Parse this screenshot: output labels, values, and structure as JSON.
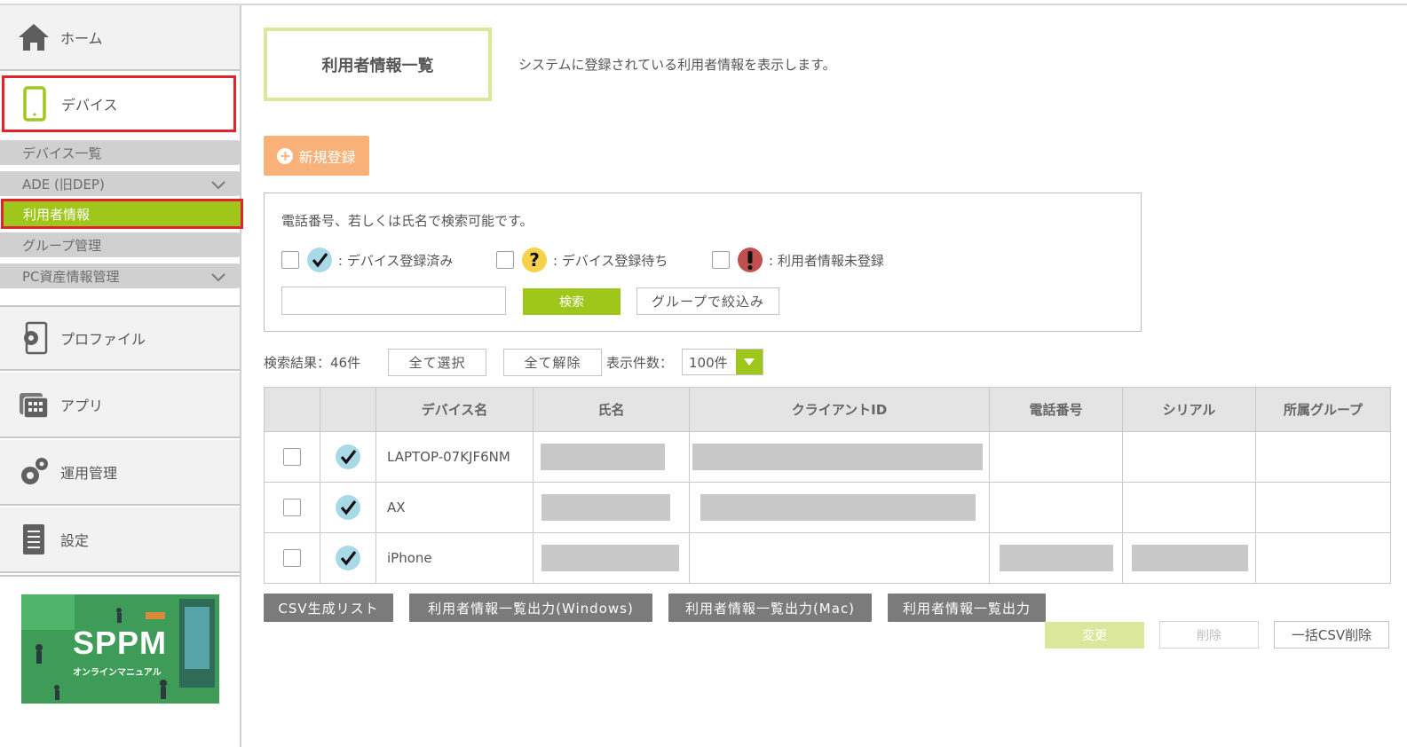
{
  "sidebar": {
    "home_label": "ホーム",
    "device_label": "デバイス",
    "submenu": [
      "デバイス一覧",
      "ADE (旧DEP)",
      "利用者情報",
      "グループ管理",
      "PC資産情報管理"
    ],
    "profile_label": "プロファイル",
    "app_label": "アプリ",
    "ops_label": "運用管理",
    "settings_label": "設定",
    "banner": {
      "title": "SPPM",
      "subtitle": "オンラインマニュアル"
    }
  },
  "header": {
    "title": "利用者情報一覧",
    "description": "システムに登録されている利用者情報を表示します。"
  },
  "new_button": "新規登録",
  "search": {
    "hint": "電話番号、若しくは氏名で検索可能です。",
    "filters": [
      {
        "label": ": デバイス登録済み",
        "icon": "check-circle-icon"
      },
      {
        "label": ": デバイス登録待ち",
        "icon": "question-circle-icon"
      },
      {
        "label": ": 利用者情報未登録",
        "icon": "exclamation-circle-icon"
      }
    ],
    "input_value": "",
    "search_button": "検索",
    "group_button": "グループで絞込み"
  },
  "results": {
    "count_label": "検索結果：46件",
    "select_all": "全て選択",
    "deselect_all": "全て解除",
    "per_page_label": "表示件数：",
    "per_page_value": "100件"
  },
  "table": {
    "headers": [
      "",
      "",
      "デバイス名",
      "氏名",
      "クライアントID",
      "電話番号",
      "シリアル",
      "所属グループ"
    ],
    "rows": [
      {
        "device": "LAPTOP-07KJF6NM"
      },
      {
        "device": "AX"
      },
      {
        "device": "iPhone"
      }
    ]
  },
  "actions": {
    "csv_list": "CSV生成リスト",
    "export_windows": "利用者情報一覧出力(Windows)",
    "export_mac": "利用者情報一覧出力(Mac)",
    "export": "利用者情報一覧出力",
    "change": "変更",
    "delete": "削除",
    "bulk_csv_delete": "一括CSV削除"
  },
  "colors": {
    "accent_green": "#9fc61b",
    "alert_red": "#e3232a",
    "orange": "#f7b179",
    "check_bg": "#a9d8e6",
    "question_bg": "#f6d24b",
    "exclaim_bg": "#c0504d"
  }
}
